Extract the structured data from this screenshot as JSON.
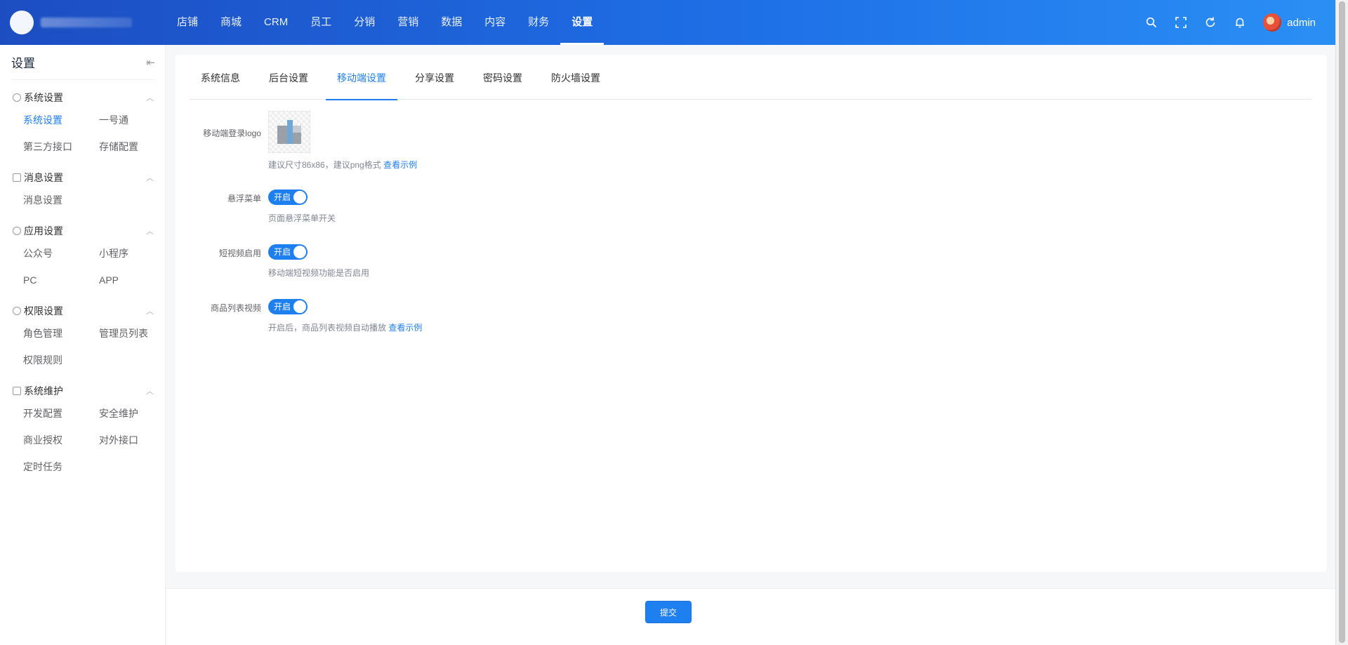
{
  "header": {
    "nav": [
      "店铺",
      "商城",
      "CRM",
      "员工",
      "分销",
      "营销",
      "数据",
      "内容",
      "财务",
      "设置"
    ],
    "active_nav": 9,
    "username": "admin",
    "icons": [
      "search-icon",
      "fullscreen-icon",
      "refresh-icon",
      "bell-icon"
    ]
  },
  "sidebar": {
    "title": "设置",
    "groups": [
      {
        "label": "系统设置",
        "icon": "gear-icon",
        "items": [
          "系统设置",
          "一号通",
          "第三方接口",
          "存储配置"
        ]
      },
      {
        "label": "消息设置",
        "icon": "envelope-icon",
        "items": [
          "消息设置"
        ]
      },
      {
        "label": "应用设置",
        "icon": "app-icon",
        "items": [
          "公众号",
          "小程序",
          "PC",
          "APP"
        ]
      },
      {
        "label": "权限设置",
        "icon": "user-icon",
        "items": [
          "角色管理",
          "管理员列表",
          "权限规则"
        ]
      },
      {
        "label": "系统维护",
        "icon": "tools-icon",
        "items": [
          "开发配置",
          "安全维护",
          "商业授权",
          "对外接口",
          "定时任务"
        ]
      }
    ],
    "active_item": "系统设置"
  },
  "tabs": [
    "系统信息",
    "后台设置",
    "移动端设置",
    "分享设置",
    "密码设置",
    "防火墙设置"
  ],
  "active_tab": 2,
  "form": {
    "logo": {
      "label": "移动端登录logo",
      "hint": "建议尺寸86x86，建议png格式",
      "link": "查看示例"
    },
    "float_menu": {
      "label": "悬浮菜单",
      "switch_text": "开启",
      "hint": "页面悬浮菜单开关"
    },
    "short_video": {
      "label": "短视频启用",
      "switch_text": "开启",
      "hint": "移动端短视频功能是否启用"
    },
    "product_video": {
      "label": "商品列表视频",
      "switch_text": "开启",
      "hint": "开启后，商品列表视频自动播放",
      "link": "查看示例"
    }
  },
  "footer": {
    "submit_label": "提交"
  },
  "colors": {
    "primary": "#1d7ff0",
    "header_start": "#1d4dc2",
    "header_end": "#2a8ff5"
  }
}
